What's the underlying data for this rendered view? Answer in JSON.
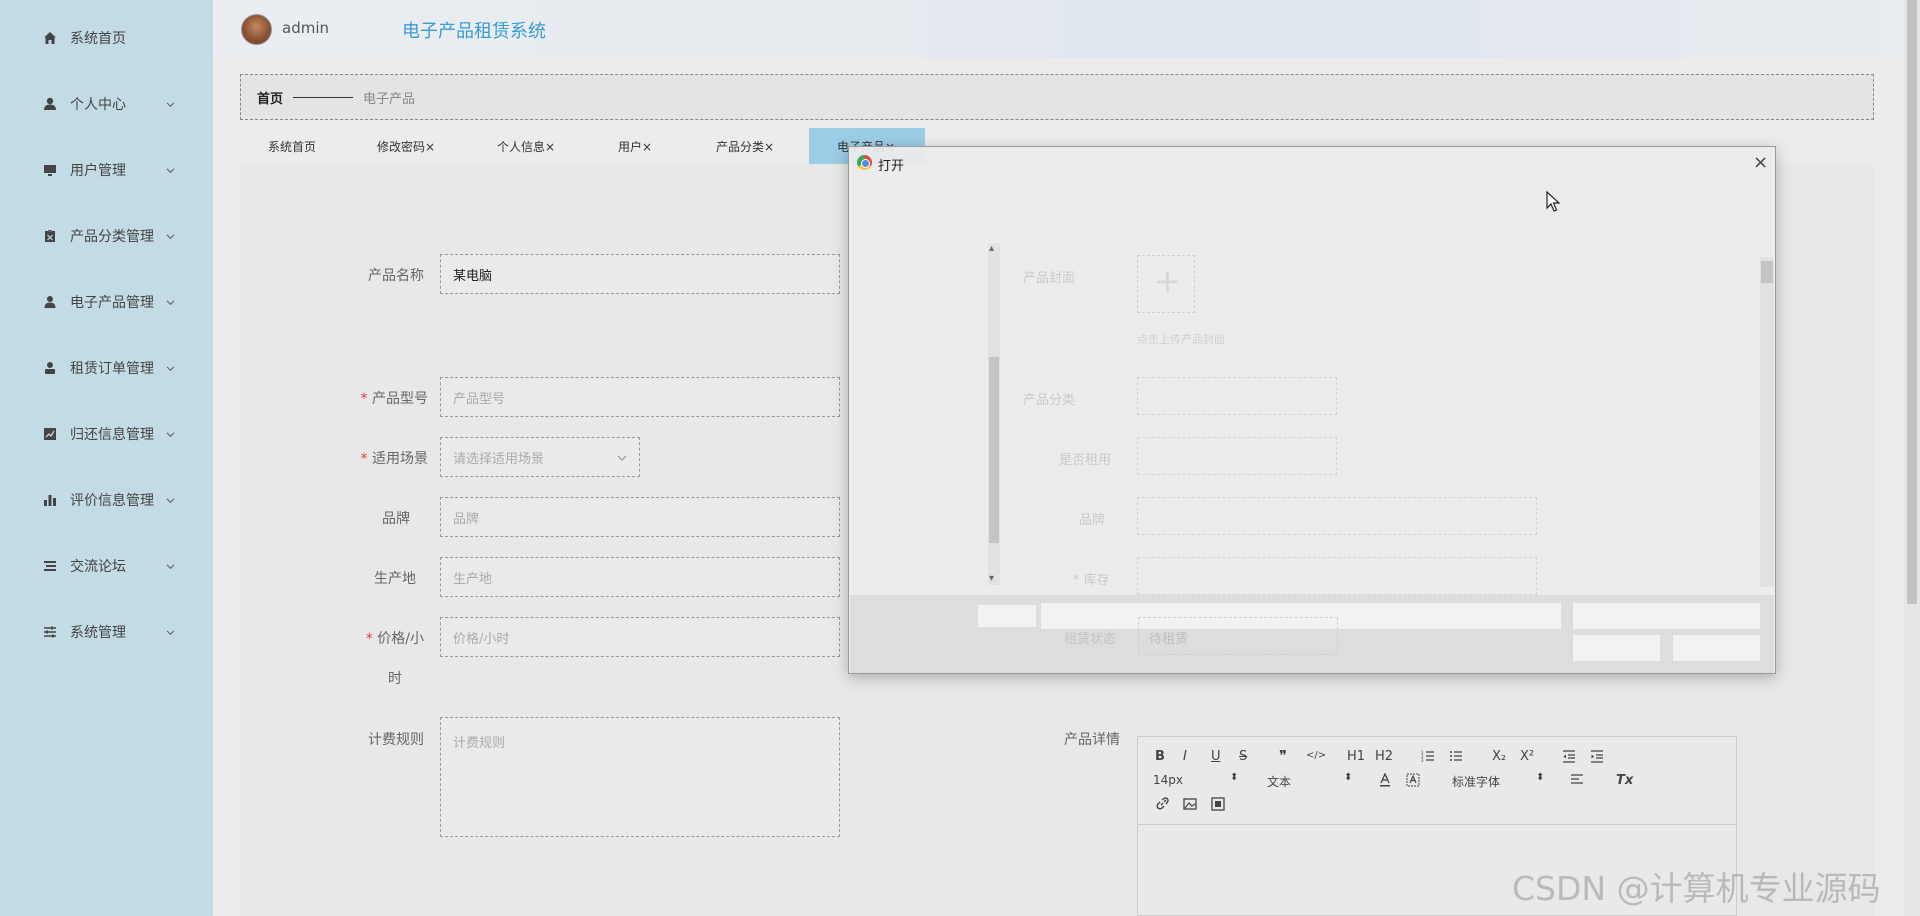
{
  "sidebar": {
    "items": [
      {
        "label": "系统首页",
        "icon": "home-icon"
      },
      {
        "label": "个人中心",
        "icon": "user-icon"
      },
      {
        "label": "用户管理",
        "icon": "monitor-icon"
      },
      {
        "label": "产品分类管理",
        "icon": "clipboard-icon"
      },
      {
        "label": "电子产品管理",
        "icon": "user-group-icon"
      },
      {
        "label": "租赁订单管理",
        "icon": "user-pin-icon"
      },
      {
        "label": "归还信息管理",
        "icon": "trend-chart-icon"
      },
      {
        "label": "评价信息管理",
        "icon": "bar-chart-icon"
      },
      {
        "label": "交流论坛",
        "icon": "list-icon"
      },
      {
        "label": "系统管理",
        "icon": "sliders-icon"
      }
    ]
  },
  "header": {
    "username": "admin",
    "system_title": "电子产品租赁系统"
  },
  "breadcrumb": {
    "home": "首页",
    "current": "电子产品"
  },
  "tabs": [
    {
      "label": "系统首页"
    },
    {
      "label": "修改密码×"
    },
    {
      "label": "个人信息×"
    },
    {
      "label": "用户×"
    },
    {
      "label": "产品分类×"
    },
    {
      "label": "电子产品×"
    }
  ],
  "form": {
    "product_name_label": "产品名称",
    "product_name_value": "某电脑",
    "model_label": "产品型号",
    "model_placeholder": "产品型号",
    "scene_label": "适用场景",
    "scene_placeholder": "请选择适用场景",
    "brand_label": "品牌",
    "brand_placeholder": "品牌",
    "origin_label": "生产地",
    "origin_placeholder": "生产地",
    "price_label_line1": "价格/小",
    "price_label_line2": "时",
    "price_placeholder": "价格/小时",
    "rules_label": "计费规则",
    "rules_placeholder": "计费规则",
    "details_label": "产品详情",
    "required_mark": "*"
  },
  "editor": {
    "font_size": "14px",
    "text_type": "文本",
    "font_family": "标准字体",
    "buttons": [
      "B",
      "I",
      "U",
      "S",
      "❞",
      "</>",
      "H1",
      "H2",
      "X₂",
      "X²",
      "Tx"
    ]
  },
  "dialog": {
    "title": "打开",
    "close": "×",
    "bg_labels": [
      "产品封面",
      "点击上传产品封面",
      "产品分类",
      "是否租用",
      "品牌",
      "* 库存",
      "租赁状态"
    ],
    "bg_values": [
      "待租赁"
    ]
  },
  "watermark": "CSDN @计算机专业源码"
}
